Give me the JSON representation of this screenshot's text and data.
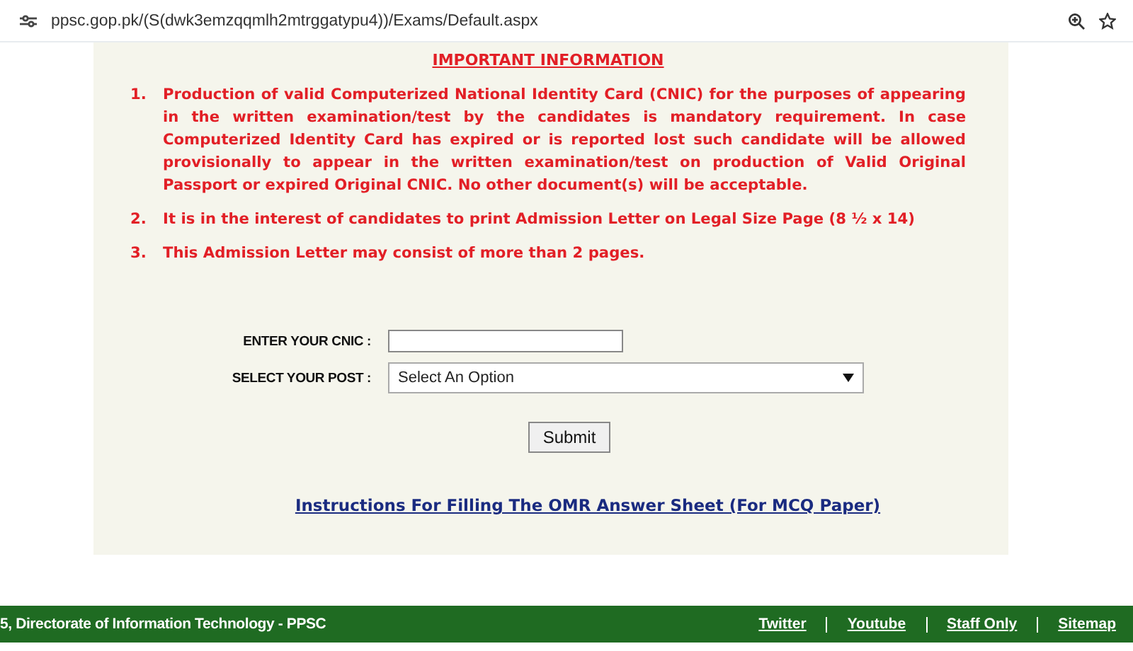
{
  "browser": {
    "url": "ppsc.gop.pk/(S(dwk3emzqqmlh2mtrggatypu4))/Exams/Default.aspx"
  },
  "notice": {
    "title": "IMPORTANT INFORMATION",
    "items": [
      {
        "number": "1.",
        "text": "Production of valid Computerized National Identity Card (CNIC) for the purposes of appearing in the written examination/test by the candidates is mandatory requirement. In case Computerized Identity Card has expired or is reported lost such candidate will be allowed provisionally to appear in the written examination/test on production of Valid Original Passport or expired Original CNIC. No other document(s) will be acceptable."
      },
      {
        "number": "2.",
        "text": "It is in the interest of candidates to print Admission Letter on Legal Size Page (8 ½ x 14)"
      },
      {
        "number": "3.",
        "text": "This Admission Letter may consist of more than 2 pages."
      }
    ]
  },
  "form": {
    "cnic_label": "ENTER YOUR CNIC :",
    "post_label": "SELECT YOUR POST :",
    "post_value": "Select An Option",
    "submit": "Submit"
  },
  "omr_link": "Instructions For Filling The OMR Answer Sheet (For MCQ Paper)",
  "footer": {
    "text": "5, Directorate of Information Technology - PPSC",
    "links": [
      "Twitter",
      "Youtube",
      "Staff Only",
      "Sitemap"
    ]
  }
}
